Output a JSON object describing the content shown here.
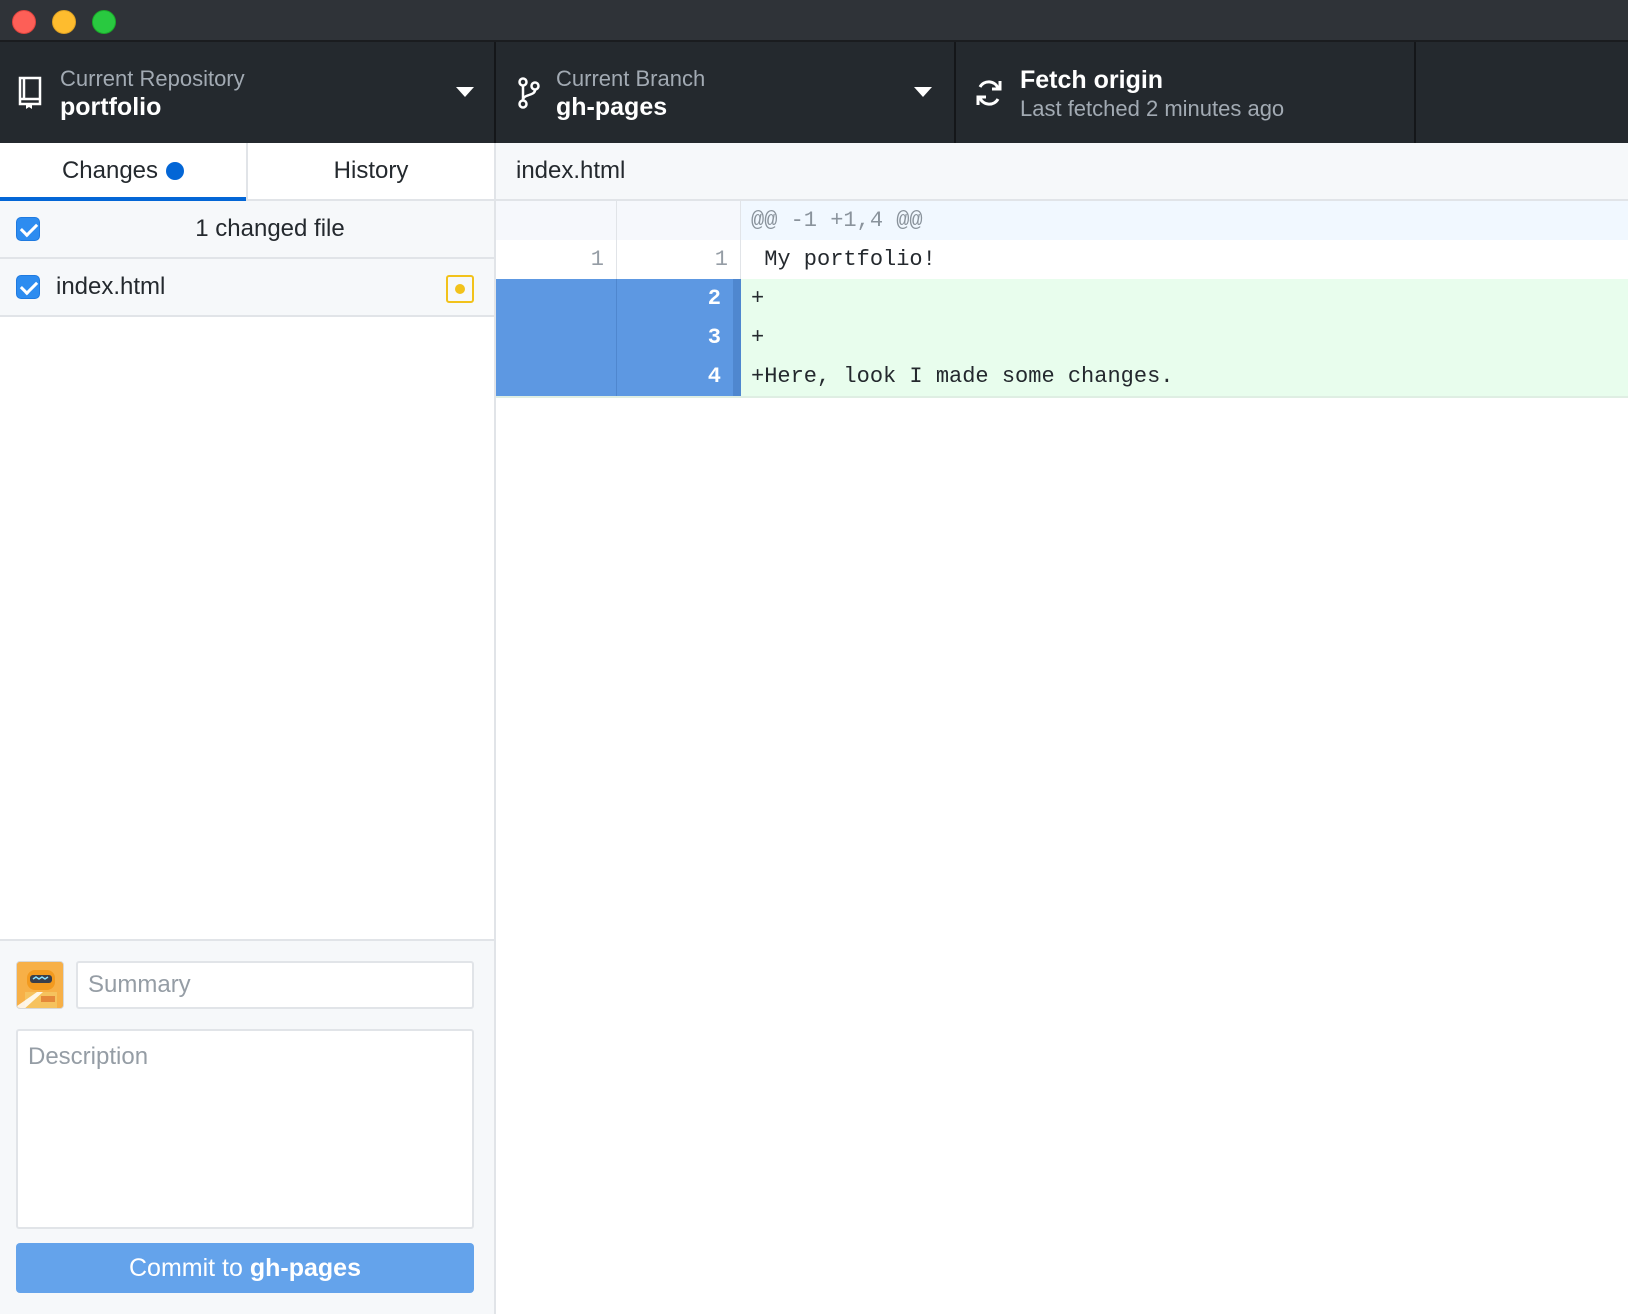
{
  "toolbar": {
    "repository": {
      "label": "Current Repository",
      "value": "portfolio"
    },
    "branch": {
      "label": "Current Branch",
      "value": "gh-pages"
    },
    "fetch": {
      "title": "Fetch origin",
      "subtitle": "Last fetched 2 minutes ago"
    }
  },
  "tabs": {
    "changes": "Changes",
    "history": "History"
  },
  "changes": {
    "count_label": "1 changed file",
    "files": [
      {
        "name": "index.html",
        "status": "modified"
      }
    ]
  },
  "commit": {
    "summary_placeholder": "Summary",
    "description_placeholder": "Description",
    "button_prefix": "Commit to ",
    "button_branch": "gh-pages"
  },
  "diff": {
    "filename": "index.html",
    "hunk_header": "@@ -1 +1,4 @@",
    "lines": [
      {
        "old": "1",
        "new": "1",
        "text": " My portfolio!"
      },
      {
        "old": "",
        "new": "2",
        "text": "+"
      },
      {
        "old": "",
        "new": "3",
        "text": "+"
      },
      {
        "old": "",
        "new": "4",
        "text": "+Here, look I made some changes."
      }
    ]
  },
  "colors": {
    "accent": "#0366d6",
    "toolbar_bg": "#24292e",
    "added_line_bg": "#e6ffed",
    "selected_gutter": "#5d98e2",
    "modified_badge": "#f2c21b",
    "commit_button": "#64a3eb"
  }
}
